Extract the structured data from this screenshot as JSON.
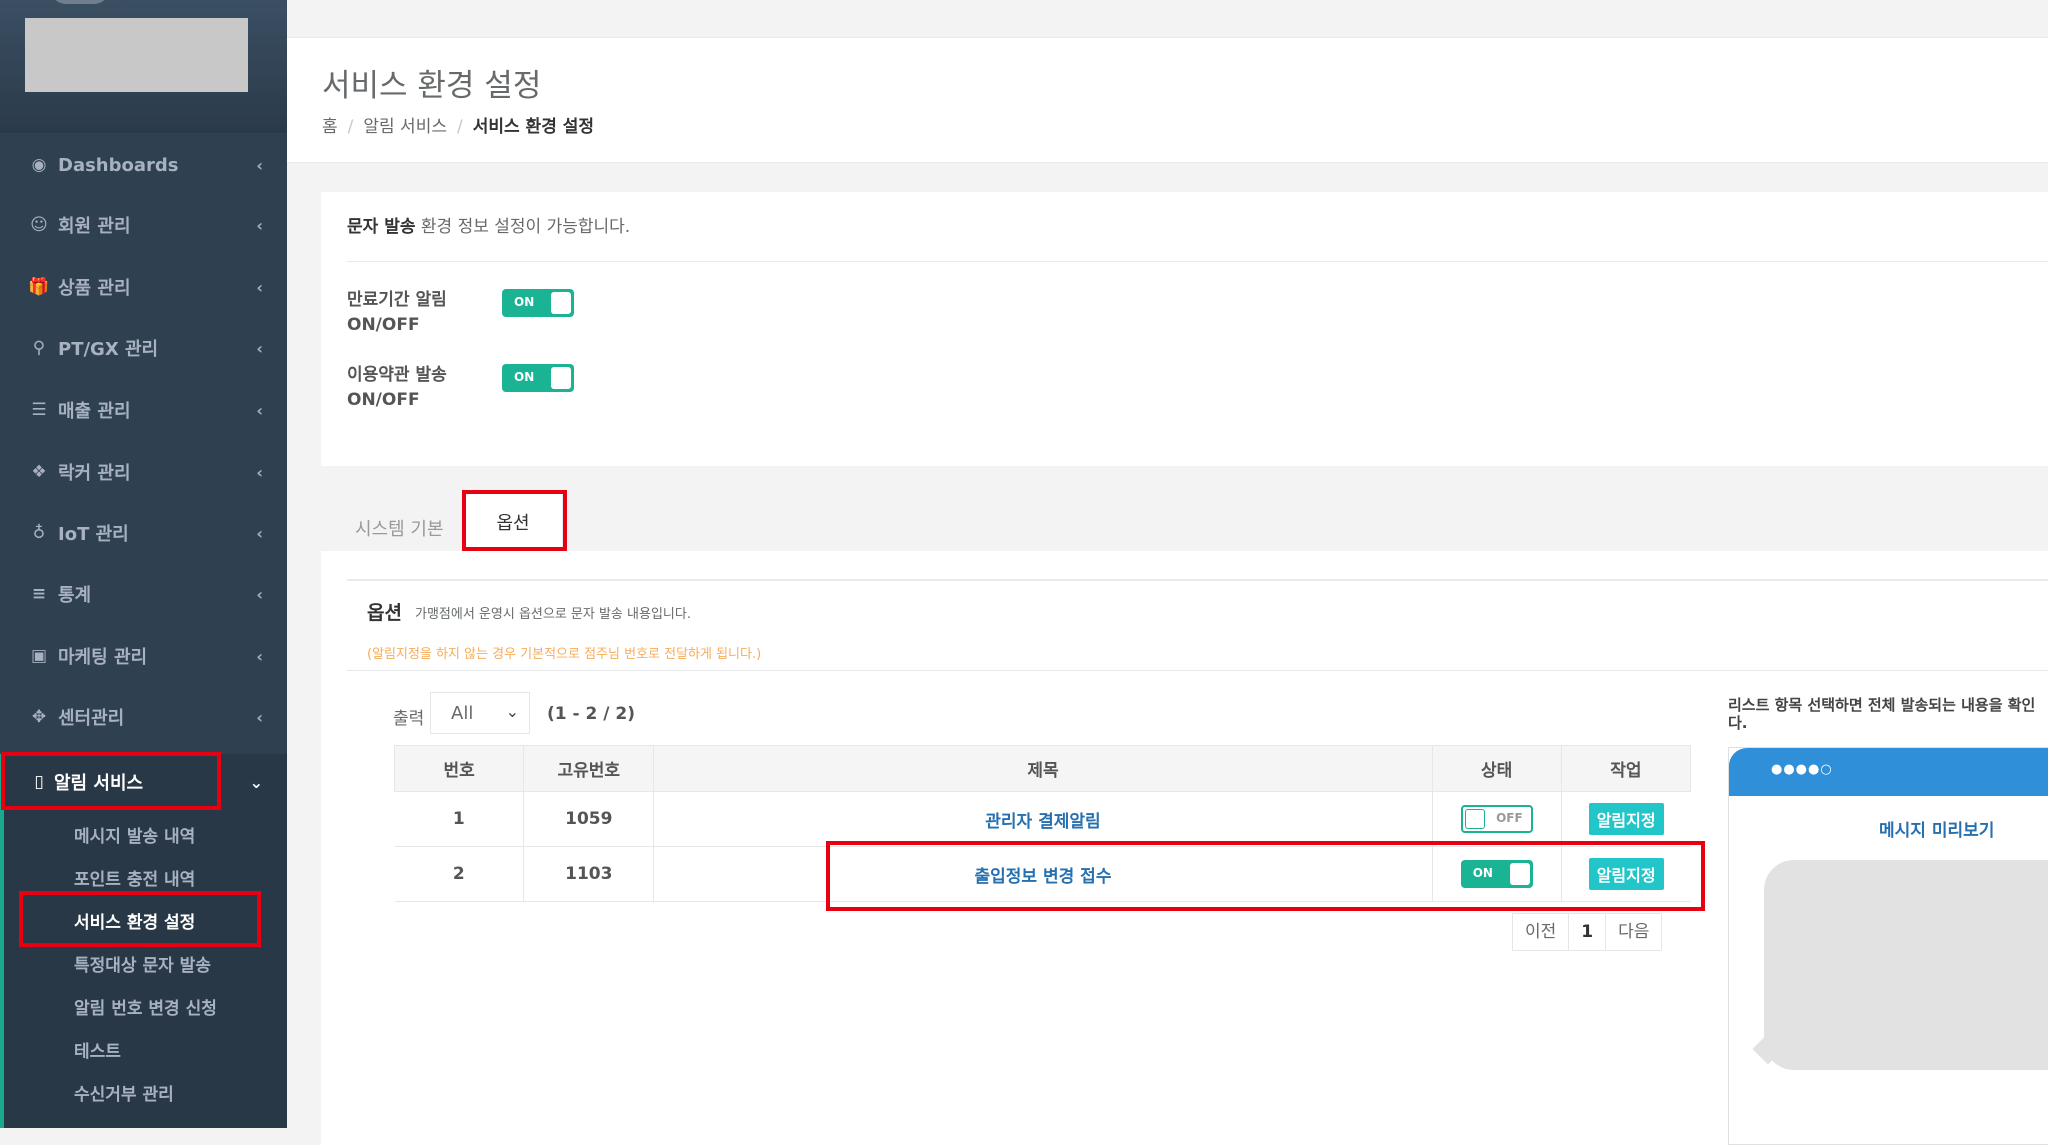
{
  "sidebar": {
    "items": [
      {
        "icon": "dashboard-icon",
        "glyph": "◉",
        "label": "Dashboards"
      },
      {
        "icon": "smile-icon",
        "glyph": "☺",
        "label": "회원 관리"
      },
      {
        "icon": "gift-icon",
        "glyph": "🎁",
        "label": "상품 관리"
      },
      {
        "icon": "bicycle-icon",
        "glyph": "⚲",
        "label": "PT/GX 관리"
      },
      {
        "icon": "list-icon",
        "glyph": "☰",
        "label": "매출 관리"
      },
      {
        "icon": "cubes-icon",
        "glyph": "❖",
        "label": "락커 관리"
      },
      {
        "icon": "lightbulb-icon",
        "glyph": "♁",
        "label": "IoT 관리"
      },
      {
        "icon": "database-icon",
        "glyph": "≡",
        "label": "통계"
      },
      {
        "icon": "image-icon",
        "glyph": "▣",
        "label": "마케팅 관리"
      },
      {
        "icon": "arrows-icon",
        "glyph": "✥",
        "label": "센터관리"
      },
      {
        "icon": "mobile-icon",
        "glyph": "▯",
        "label": "알림 서비스"
      }
    ],
    "arrow_collapsed": "‹",
    "arrow_expanded": "⌄",
    "submenu": [
      "메시지 발송 내역",
      "포인트 충전 내역",
      "서비스 환경 설정",
      "특정대상 문자 발송",
      "알림 번호 변경 신청",
      "테스트",
      "수신거부 관리"
    ]
  },
  "header": {
    "title": "서비스 환경 설정",
    "breadcrumb": [
      "홈",
      "알림 서비스",
      "서비스 환경 설정"
    ],
    "separator": "/"
  },
  "settings": {
    "desc_bold": "문자 발송",
    "desc_rest": " 환경 정보 설정이 가능합니다.",
    "switches": [
      {
        "label_line1": "만료기간 알림",
        "label_line2": "ON/OFF",
        "state": "ON"
      },
      {
        "label_line1": "이용약관 발송",
        "label_line2": "ON/OFF",
        "state": "ON"
      }
    ]
  },
  "tabs": [
    {
      "label": "시스템 기본"
    },
    {
      "label": "옵션"
    }
  ],
  "options": {
    "title": "옵션",
    "desc": "가맹점에서 운영시 옵션으로 문자 발송 내용입니다.",
    "warning": "(알림지정을 하지 않는 경우 기본적으로 점주님 번호로 전달하게 됩니다.)",
    "output_label": "출력",
    "output_value": "All",
    "range": "(1 - 2 / 2)",
    "columns": [
      "번호",
      "고유번호",
      "제목",
      "상태",
      "작업"
    ],
    "rows": [
      {
        "no": "1",
        "uid": "1059",
        "title": "관리자 결제알림",
        "status": "OFF",
        "action": "알림지정"
      },
      {
        "no": "2",
        "uid": "1103",
        "title": "출입정보 변경 접수",
        "status": "ON",
        "action": "알림지정"
      }
    ],
    "pager": {
      "prev": "이전",
      "current": "1",
      "next": "다음"
    }
  },
  "preview": {
    "hint_line1": "리스트 항목 선택하면 전체 발송되는 내용을 확인",
    "hint_line2": "다.",
    "dots": "●●●●○",
    "title": "메시지 미리보기"
  },
  "colors": {
    "sidebar_bg": "#2f4050",
    "accent": "#1ab394",
    "alarm_btn": "#23c6c8",
    "link": "#2670b0",
    "highlight_box": "#e60012",
    "warning": "#f8ac59"
  }
}
